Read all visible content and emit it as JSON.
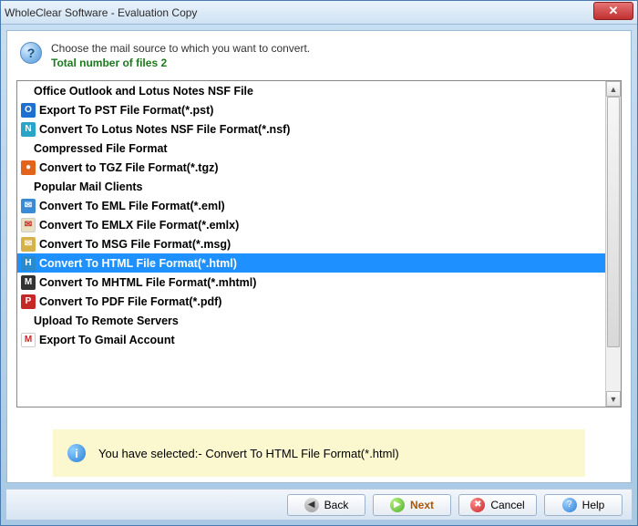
{
  "window": {
    "title": "WholeClear Software - Evaluation Copy"
  },
  "header": {
    "line1": "Choose the mail source to which you want to convert.",
    "line2": "Total number of files 2"
  },
  "list": [
    {
      "kind": "group",
      "label": "Office Outlook and Lotus Notes NSF File"
    },
    {
      "kind": "item",
      "label": "Export To PST File Format(*.pst)",
      "icon": "outlook",
      "selected": false
    },
    {
      "kind": "item",
      "label": "Convert To Lotus Notes NSF File Format(*.nsf)",
      "icon": "nsf",
      "selected": false
    },
    {
      "kind": "group",
      "label": "Compressed File Format"
    },
    {
      "kind": "item",
      "label": "Convert to TGZ File Format(*.tgz)",
      "icon": "tgz",
      "selected": false
    },
    {
      "kind": "group",
      "label": "Popular Mail Clients"
    },
    {
      "kind": "item",
      "label": "Convert To EML File Format(*.eml)",
      "icon": "eml",
      "selected": false
    },
    {
      "kind": "item",
      "label": "Convert To EMLX File Format(*.emlx)",
      "icon": "emlx",
      "selected": false
    },
    {
      "kind": "item",
      "label": "Convert To MSG File Format(*.msg)",
      "icon": "msg",
      "selected": false
    },
    {
      "kind": "item",
      "label": "Convert To HTML File Format(*.html)",
      "icon": "html",
      "selected": true
    },
    {
      "kind": "item",
      "label": "Convert To MHTML File Format(*.mhtml)",
      "icon": "mhtml",
      "selected": false
    },
    {
      "kind": "item",
      "label": "Convert To PDF File Format(*.pdf)",
      "icon": "pdf",
      "selected": false
    },
    {
      "kind": "group",
      "label": "Upload To Remote Servers"
    },
    {
      "kind": "item",
      "label": "Export To Gmail Account",
      "icon": "gmail",
      "selected": false
    }
  ],
  "notice": {
    "text": "You have selected:- Convert To HTML File Format(*.html)"
  },
  "buttons": {
    "back": "Back",
    "next": "Next",
    "cancel": "Cancel",
    "help": "Help"
  },
  "icons": {
    "outlook": {
      "bg": "#1f6fd1",
      "glyph": "O"
    },
    "nsf": {
      "bg": "#2aa5c9",
      "glyph": "N"
    },
    "tgz": {
      "bg": "#e2641c",
      "glyph": "●"
    },
    "eml": {
      "bg": "#3a8ad6",
      "glyph": "✉"
    },
    "emlx": {
      "bg": "#e8e0c0",
      "glyph": "✉"
    },
    "msg": {
      "bg": "#d6b34a",
      "glyph": "✉"
    },
    "html": {
      "bg": "#2a8acb",
      "glyph": "H"
    },
    "mhtml": {
      "bg": "#333333",
      "glyph": "M"
    },
    "pdf": {
      "bg": "#c62828",
      "glyph": "P"
    },
    "gmail": {
      "bg": "#ffffff",
      "glyph": "M"
    }
  }
}
